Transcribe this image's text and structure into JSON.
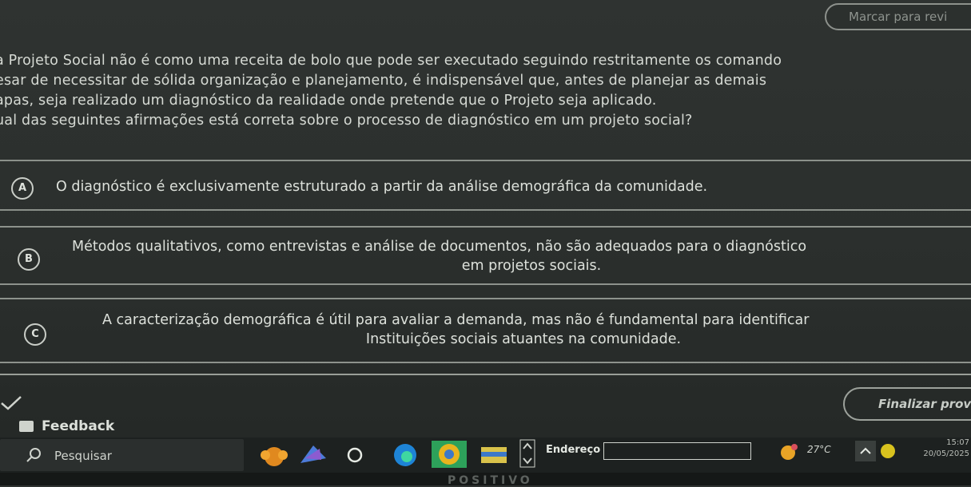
{
  "header": {
    "review_button": "Marcar para revi"
  },
  "question": {
    "lines": [
      "a Projeto Social não é como uma receita de bolo que pode ser executado seguindo restritamente os comando",
      "esar de necessitar de sólida organização e planejamento, é indispensável que, antes de planejar as demais",
      "apas, seja realizado um diagnóstico da realidade onde pretende que o Projeto seja aplicado.",
      "ual das seguintes afirmações está correta sobre o processo de diagnóstico em um projeto social?"
    ]
  },
  "options": {
    "a": {
      "letter": "A",
      "text": "O diagnóstico é exclusivamente estruturado a partir da análise demográfica da comunidade."
    },
    "b": {
      "letter": "B",
      "line1": "Métodos qualitativos, como entrevistas e análise de documentos, não são adequados para o diagnóstico",
      "line2": "em projetos sociais."
    },
    "c": {
      "letter": "C",
      "line1": "A caracterização demográfica é útil para avaliar a demanda, mas não é fundamental para identificar",
      "line2": "Instituições sociais atuantes na comunidade."
    }
  },
  "footer": {
    "finalizar": "Finalizar prov",
    "feedback": "Feedback"
  },
  "taskbar": {
    "search_label": "Pesquisar",
    "address_label": "Endereço",
    "temperature": "27°C",
    "time": "15:07",
    "date": "20/05/2025"
  },
  "brand": "POSITIVO"
}
